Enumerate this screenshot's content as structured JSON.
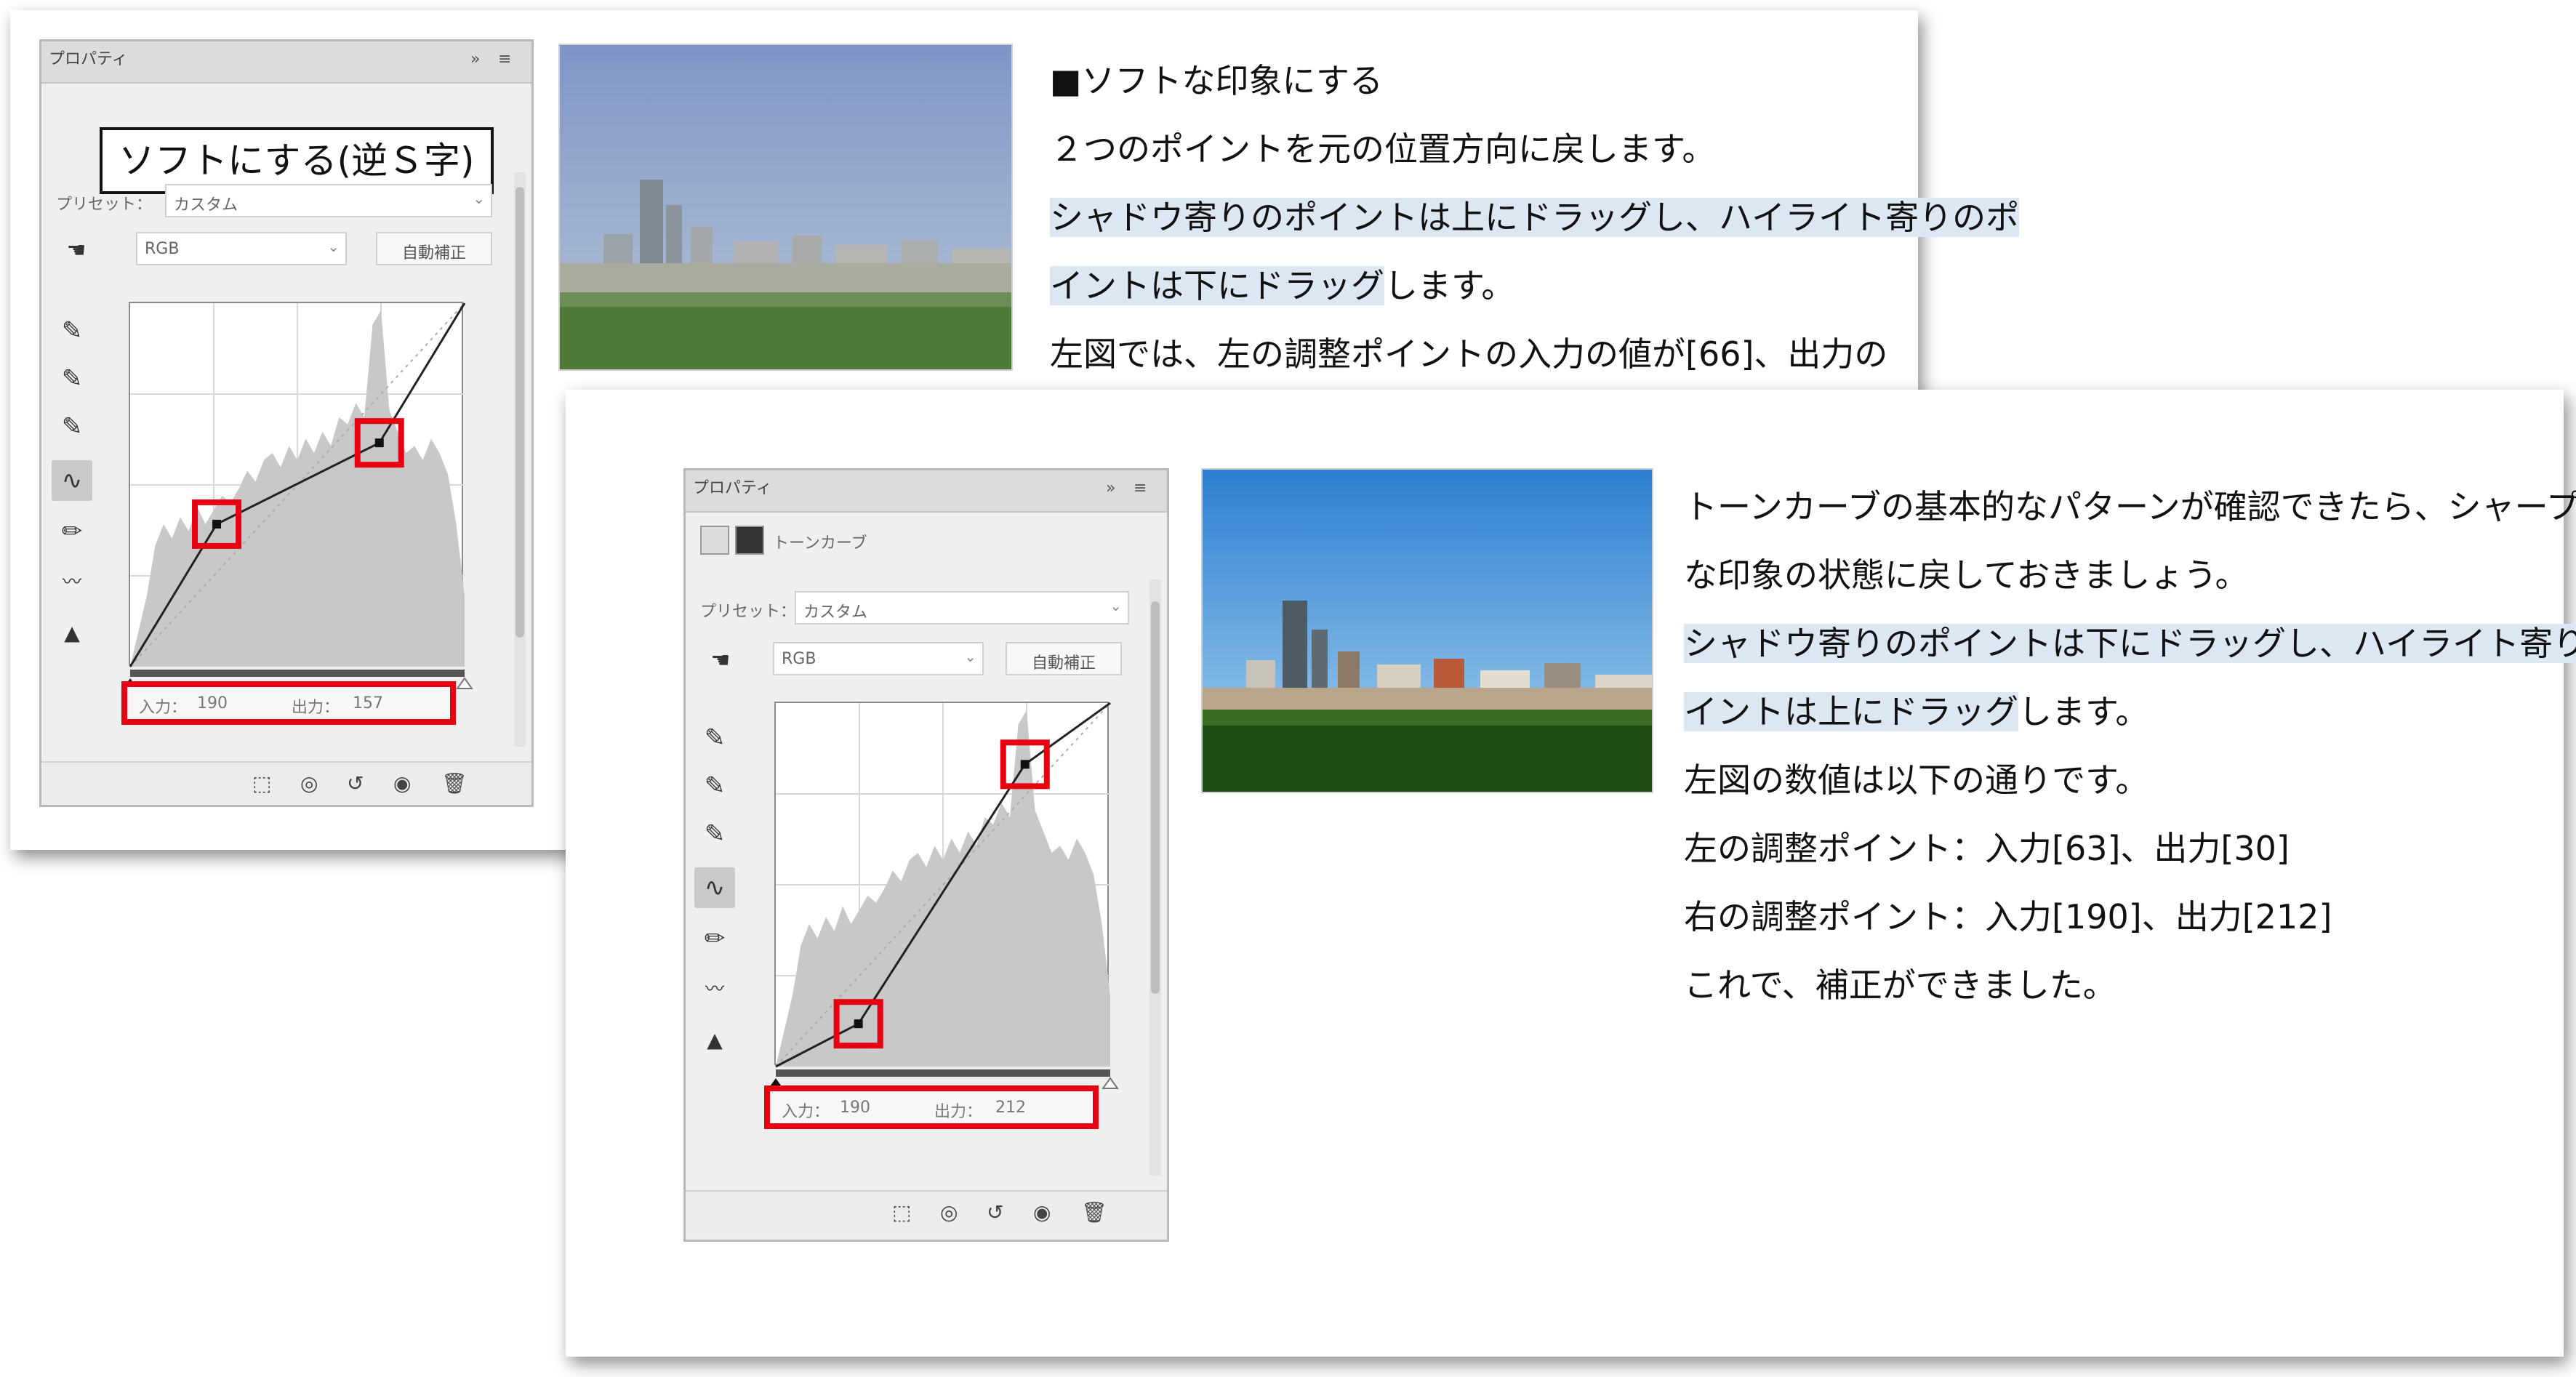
{
  "panel_common": {
    "tab": "プロパティ",
    "adjustment": "トーンカーブ",
    "preset_label": "プリセット：",
    "channel": "RGB",
    "auto_button": "自動補正",
    "input_label": "入力：",
    "output_label": "出力："
  },
  "back_panel": {
    "callout": "ソフトにする(逆Ｓ字)",
    "preset_value": "カスタム",
    "input_value": "190",
    "output_value": "157"
  },
  "front_panel": {
    "preset_value": "カスタム",
    "input_value": "190",
    "output_value": "212"
  },
  "back_text": {
    "heading": "■ソフトな印象にする",
    "line1": "２つのポイントを元の位置方向に戻します。",
    "line2_a": "シャドウ寄りのポイントは上にドラッグし、",
    "line2_b": "ハイライト寄りのポ",
    "line3_a": "イントは下にドラッグ",
    "line3_b": "します。",
    "line4": "左図では、左の調整ポイントの入力の値が[66]、出力の"
  },
  "front_text": {
    "line1": "トーンカーブの基本的なパターンが確認できたら、シャープ",
    "line2": "な印象の状態に戻しておきましょう。",
    "line3_a": "シャドウ寄りのポイントは下にドラッグし、",
    "line3_b": "ハイライト寄りのポ",
    "line4_a": "イントは上にドラッグ",
    "line4_b": "します。",
    "line5": "左図の数値は以下の通りです。",
    "line6": "左の調整ポイント：入力[63]、出力[30]",
    "line7": "右の調整ポイント：入力[190]、出力[212]",
    "line8": "これで、補正ができました。"
  },
  "back_curve": {
    "points": [
      {
        "input": 66,
        "output": 100
      },
      {
        "input": 190,
        "output": 157
      }
    ]
  },
  "front_curve": {
    "points": [
      {
        "input": 63,
        "output": 30
      },
      {
        "input": 190,
        "output": 212
      }
    ]
  },
  "colors": {
    "highlight_box": "#e60012",
    "text_highlight": "#dde7f3",
    "histogram": "#c8c8c8"
  }
}
